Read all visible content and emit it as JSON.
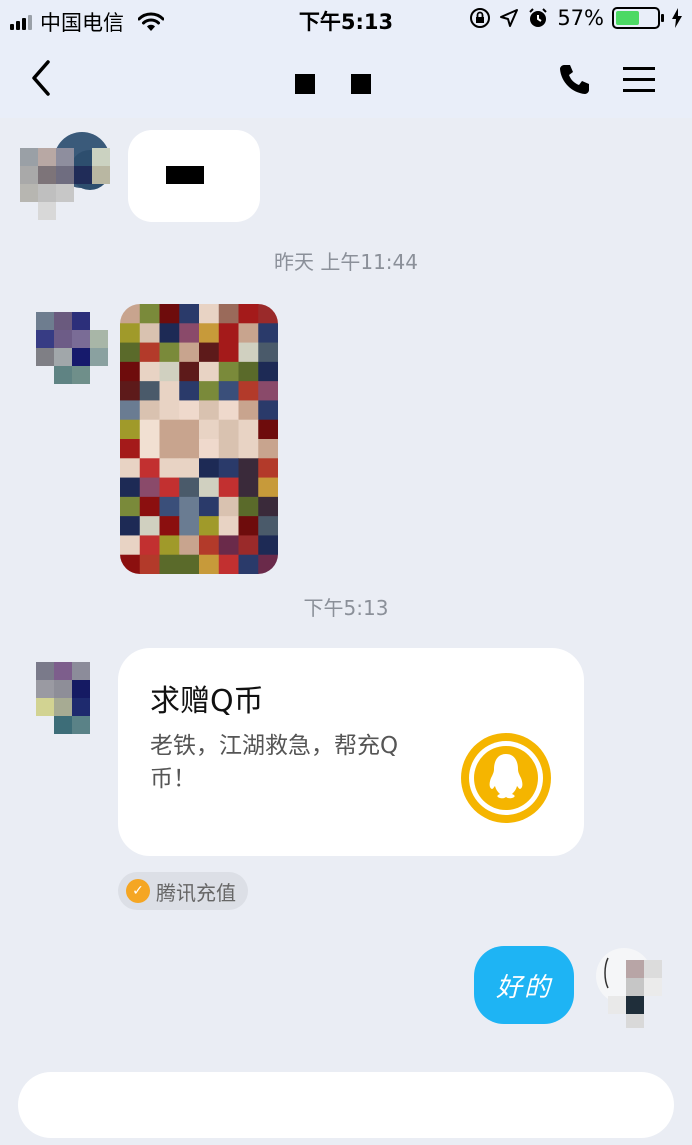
{
  "status_bar": {
    "carrier": "中国电信",
    "time": "下午5:13",
    "battery_percent": "57%",
    "battery_level": 0.57,
    "icons": [
      "signal-icon",
      "wifi-icon",
      "orientation-lock-icon",
      "location-icon",
      "alarm-icon",
      "battery-icon",
      "charging-icon"
    ]
  },
  "nav": {
    "title": "",
    "icons": [
      "back-chevron-icon",
      "phone-icon",
      "menu-icon"
    ]
  },
  "messages": {
    "timestamp_1": "昨天 上午11:44",
    "timestamp_2": "下午5:13",
    "card": {
      "title": "求赠Q币",
      "description": "老铁，江湖救急，帮充Q币！",
      "icon": "qq-penguin-coin-icon",
      "source_label": "腾讯充值"
    },
    "reply_text": "好的"
  },
  "colors": {
    "background": "#eaedf4",
    "header": "#e9eef9",
    "outgoing_bubble": "#1eb4f4",
    "coin_gold": "#f5b500",
    "source_badge_check": "#f5a623"
  }
}
